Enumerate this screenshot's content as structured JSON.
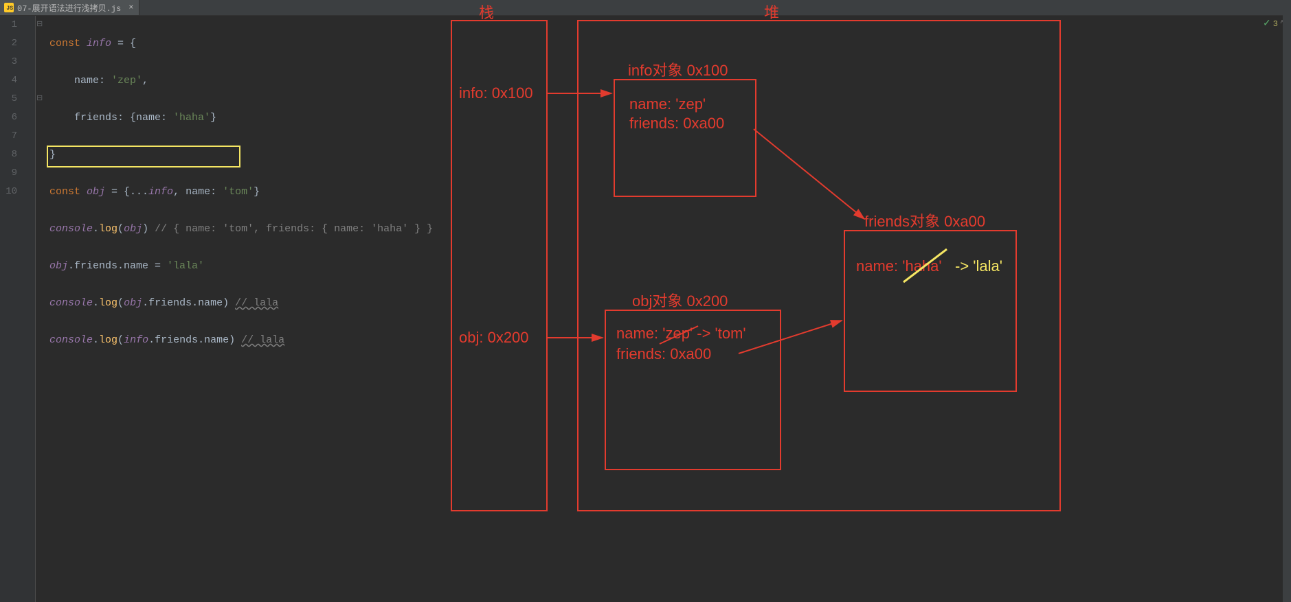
{
  "tab": {
    "filename": "07-展开语法进行浅拷贝.js"
  },
  "status": {
    "check": "✓",
    "warn_count": "3",
    "caret": "^"
  },
  "code": {
    "l1": {
      "kw": "const ",
      "id": "info",
      "rest": " = {"
    },
    "l2": {
      "plain1": "    name: ",
      "str": "'zep'",
      "plain2": ","
    },
    "l3": {
      "plain1": "    friends: {name: ",
      "str": "'haha'",
      "plain2": "}"
    },
    "l4": {
      "plain": "}"
    },
    "l5": {
      "kw": "const ",
      "id1": "obj",
      "plain1": " = {...",
      "id2": "info",
      "plain2": ", name: ",
      "str": "'tom'",
      "plain3": "}"
    },
    "l6": {
      "id1": "console",
      "plain1": ".",
      "fn": "log",
      "plain2": "(",
      "id2": "obj",
      "plain3": ") ",
      "cmt": "// { name: 'tom', friends: { name: 'haha' } }"
    },
    "l7": {
      "id1": "obj",
      "plain1": ".friends.name = ",
      "str": "'lala'"
    },
    "l8": {
      "id1": "console",
      "plain1": ".",
      "fn": "log",
      "plain2": "(",
      "id2": "obj",
      "plain3": ".friends.name) ",
      "cmt": "// lala"
    },
    "l9": {
      "id1": "console",
      "plain1": ".",
      "fn": "log",
      "plain2": "(",
      "id2": "info",
      "plain3": ".friends.name) ",
      "cmt": "// lala"
    }
  },
  "lines": [
    "1",
    "2",
    "3",
    "4",
    "5",
    "6",
    "7",
    "8",
    "9",
    "10"
  ],
  "diagram": {
    "stack_label": "栈",
    "heap_label": "堆",
    "stack": {
      "info": "info: 0x100",
      "obj": "obj: 0x200"
    },
    "heap": {
      "info_title": "info对象 0x100",
      "info_line1": "name: 'zep'",
      "info_line2": "friends: 0xa00",
      "obj_title": "obj对象 0x200",
      "obj_line1a": "name: ",
      "obj_line1b": "'zep'",
      "obj_line1c": " -> 'tom'",
      "obj_line2": "friends: 0xa00",
      "friends_title": "friends对象 0xa00",
      "friends_line1a": "name: ",
      "friends_line1b": "'haha'",
      "friends_line1c": "-> 'lala'"
    }
  }
}
